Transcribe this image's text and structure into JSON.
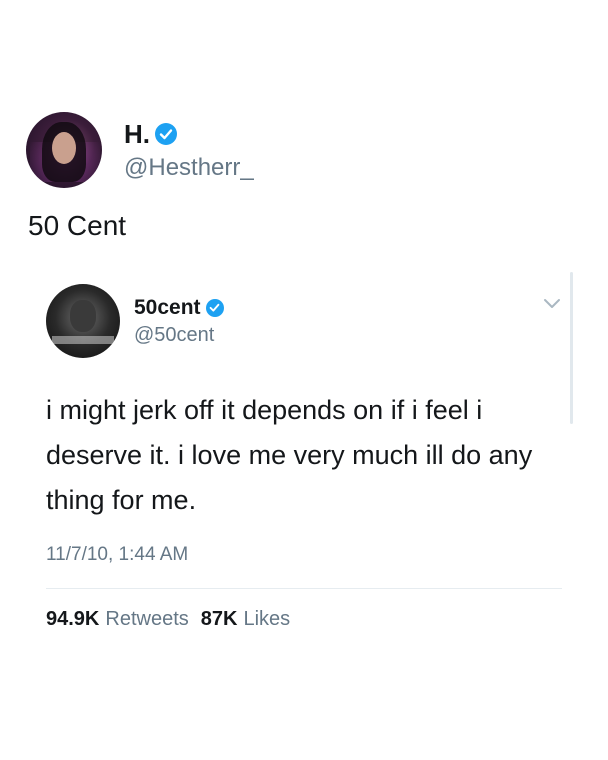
{
  "outer": {
    "display_name": "H.",
    "handle": "@Hestherr_",
    "text": "50 Cent",
    "avatar_icon": "profile-photo",
    "verified_icon": "verified-badge-icon"
  },
  "embedded": {
    "display_name": "50cent",
    "handle": "@50cent",
    "avatar_icon": "profile-photo",
    "verified_icon": "verified-badge-icon",
    "menu_icon": "chevron-down-icon",
    "text": "i might jerk off it depends on if i feel i deserve it. i love me very much ill do any thing for me.",
    "timestamp": "11/7/10, 1:44 AM",
    "retweets_count": "94.9K",
    "retweets_label": "Retweets",
    "likes_count": "87K",
    "likes_label": "Likes"
  },
  "colors": {
    "verified": "#1da1f2",
    "text": "#14171a",
    "secondary": "#657786"
  }
}
